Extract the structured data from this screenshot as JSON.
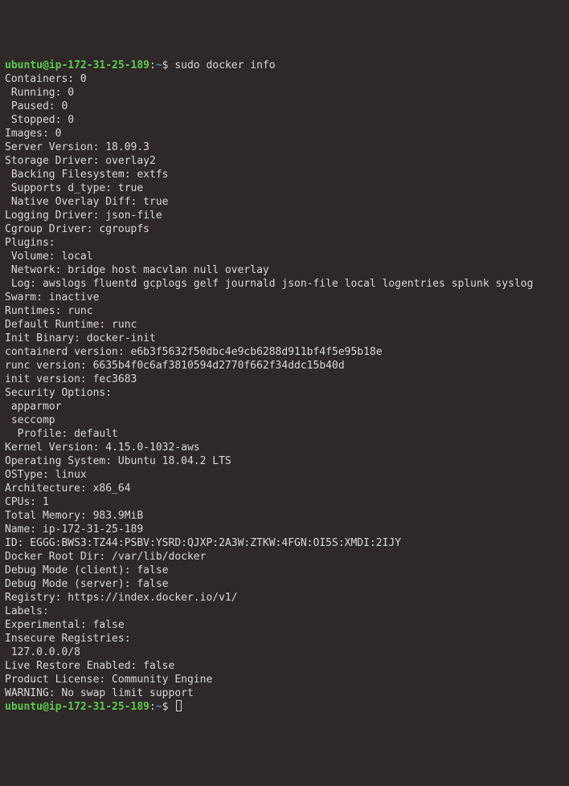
{
  "prompt": {
    "user_host": "ubuntu@ip-172-31-25-189",
    "sep1": ":",
    "path": "~",
    "sep2": "$ "
  },
  "command": "sudo docker info",
  "output": [
    "Containers: 0",
    " Running: 0",
    " Paused: 0",
    " Stopped: 0",
    "Images: 0",
    "Server Version: 18.09.3",
    "Storage Driver: overlay2",
    " Backing Filesystem: extfs",
    " Supports d_type: true",
    " Native Overlay Diff: true",
    "Logging Driver: json-file",
    "Cgroup Driver: cgroupfs",
    "Plugins:",
    " Volume: local",
    " Network: bridge host macvlan null overlay",
    " Log: awslogs fluentd gcplogs gelf journald json-file local logentries splunk syslog",
    "Swarm: inactive",
    "Runtimes: runc",
    "Default Runtime: runc",
    "Init Binary: docker-init",
    "containerd version: e6b3f5632f50dbc4e9cb6288d911bf4f5e95b18e",
    "runc version: 6635b4f0c6af3810594d2770f662f34ddc15b40d",
    "init version: fec3683",
    "Security Options:",
    " apparmor",
    " seccomp",
    "  Profile: default",
    "Kernel Version: 4.15.0-1032-aws",
    "Operating System: Ubuntu 18.04.2 LTS",
    "OSType: linux",
    "Architecture: x86_64",
    "CPUs: 1",
    "Total Memory: 983.9MiB",
    "Name: ip-172-31-25-189",
    "ID: EGGG:BWS3:TZ44:PSBV:YSRD:QJXP:2A3W:ZTKW:4FGN:OI5S:XMDI:2IJY",
    "Docker Root Dir: /var/lib/docker",
    "Debug Mode (client): false",
    "Debug Mode (server): false",
    "Registry: https://index.docker.io/v1/",
    "Labels:",
    "Experimental: false",
    "Insecure Registries:",
    " 127.0.0.0/8",
    "Live Restore Enabled: false",
    "Product License: Community Engine",
    "",
    "WARNING: No swap limit support"
  ]
}
